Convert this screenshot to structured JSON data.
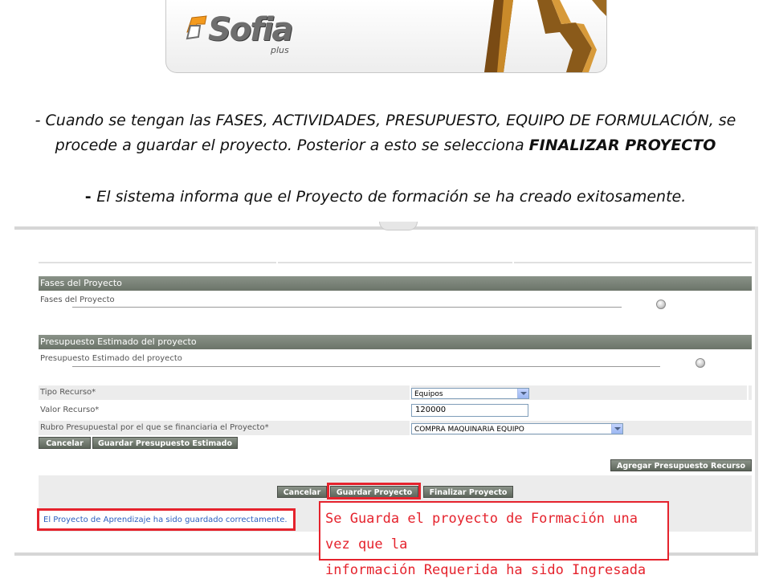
{
  "banner": {
    "logo_text": "Sofia",
    "logo_sub": "plus"
  },
  "caption": {
    "line1_prefix": "- Cuando se tengan las FASES, ACTIVIDADES, PRESUPUESTO, EQUIPO DE FORMULACIÓN, se procede a guardar el proyecto. Posterior a esto se selecciona ",
    "line1_strong": "FINALIZAR PROYECTO",
    "line2_prefix": "- ",
    "line2_text": "El sistema informa que el Proyecto de formación se ha creado exitosamente."
  },
  "fases": {
    "header": "Fases del Proyecto",
    "label": "Fases del Proyecto"
  },
  "presupuesto": {
    "header": "Presupuesto Estimado del proyecto",
    "label": "Presupuesto Estimado del proyecto"
  },
  "form": {
    "tipo_recurso_label": "Tipo Recurso*",
    "tipo_recurso_value": "Equipos",
    "valor_recurso_label": "Valor Recurso*",
    "valor_recurso_value": "120000",
    "rubro_label": "Rubro Presupuestal por el que se financiaria el Proyecto*",
    "rubro_value": "COMPRA MAQUINARIA EQUIPO"
  },
  "buttons": {
    "cancelar": "Cancelar",
    "guardar_presupuesto": "Guardar Presupuesto Estimado",
    "agregar_presupuesto": "Agregar Presupuesto Recurso",
    "cancelar2": "Cancelar",
    "guardar_proyecto": "Guardar Proyecto",
    "finalizar_proyecto": "Finalizar Proyecto"
  },
  "status_message": "El Proyecto de Aprendizaje ha sido guardado correctamente.",
  "note": {
    "line1": "Se Guarda el proyecto de Formación una vez   que la",
    "line2": "información Requerida ha sido Ingresada"
  },
  "colors": {
    "annotation_red": "#e5232d",
    "header_gray": "#6b7469",
    "message_blue": "#2d5fbf"
  }
}
